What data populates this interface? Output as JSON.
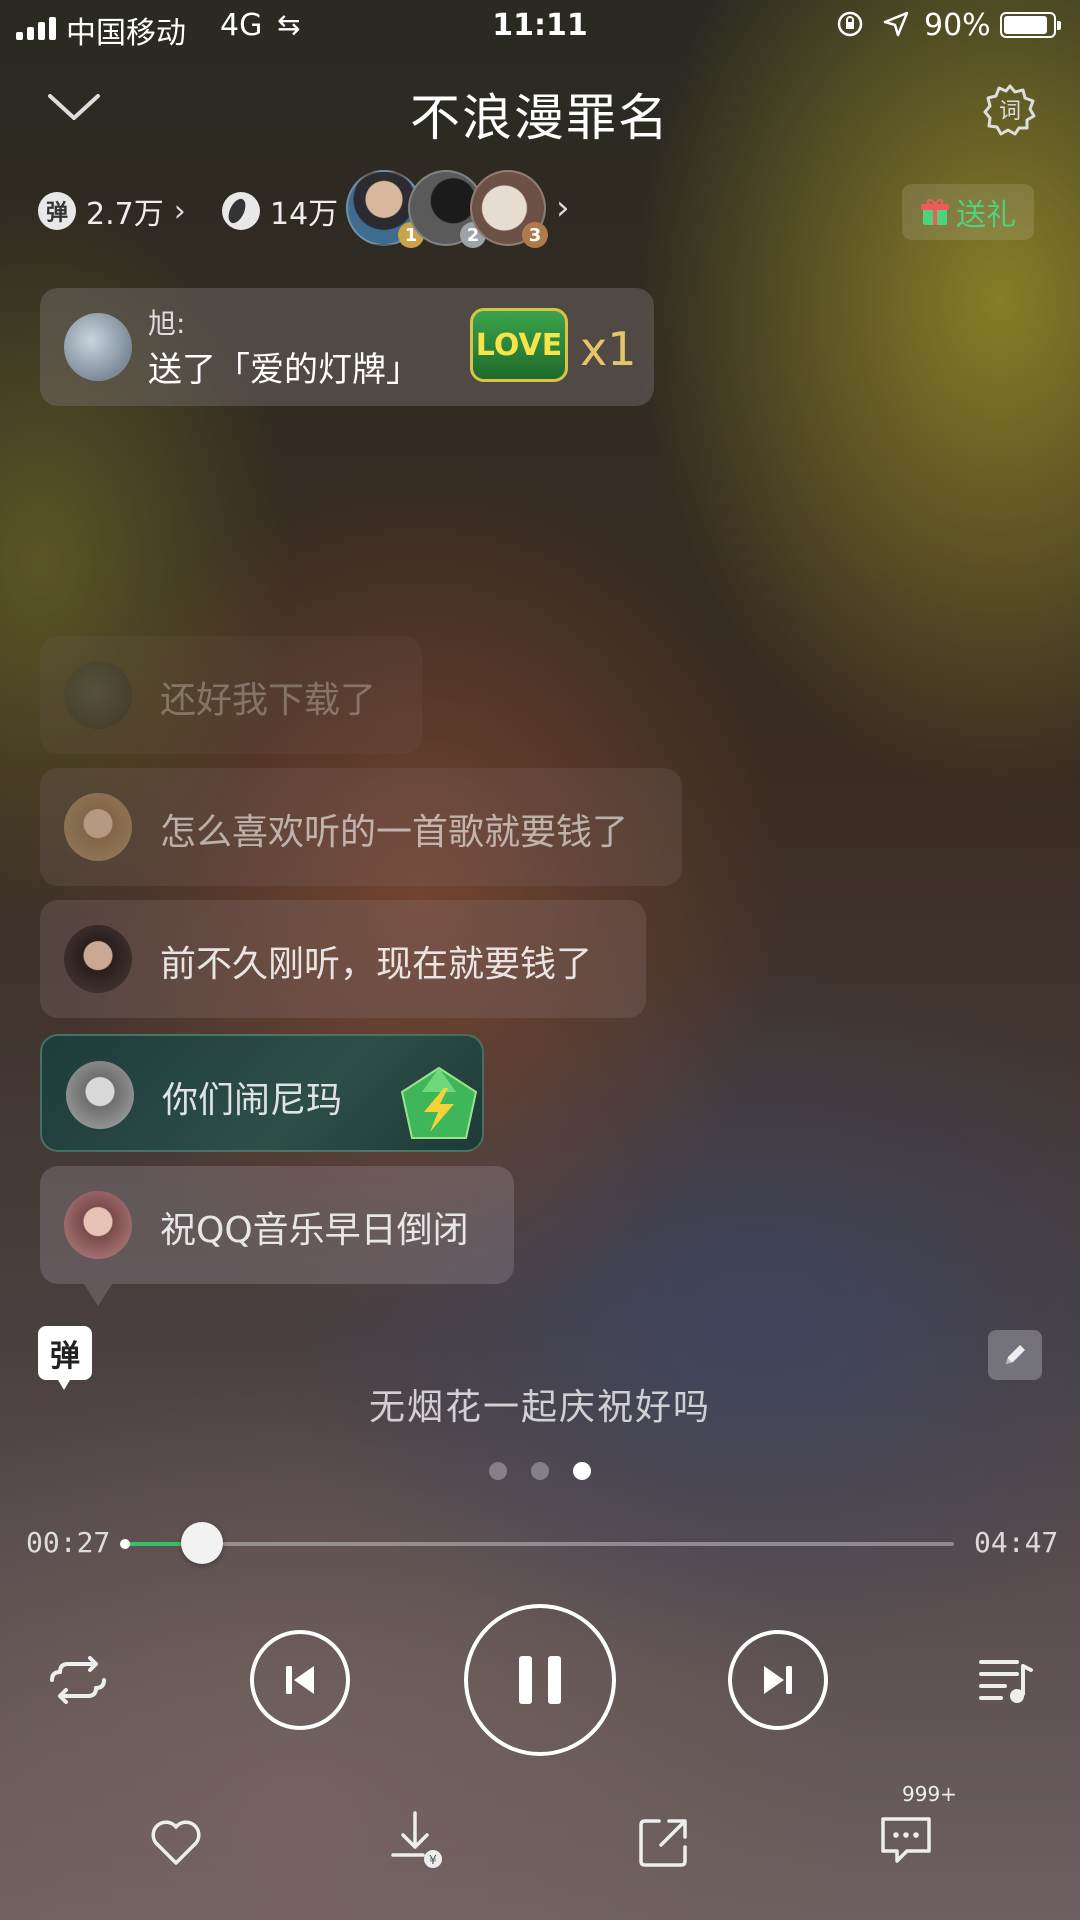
{
  "status_bar": {
    "carrier": "中国移动",
    "network": "4G",
    "time": "11:11",
    "battery_percent": "90%",
    "battery_level": 0.9
  },
  "header": {
    "song_title": "不浪漫罪名",
    "lyrics_button_label": "词"
  },
  "stats": {
    "danmu_badge": "弹",
    "danmu_count": "2.7万",
    "listeners_count": "14万",
    "ranks": [
      "1",
      "2",
      "3"
    ],
    "gift_button_label": "送礼"
  },
  "gift_notice": {
    "user": "旭:",
    "action": "送了「爱的灯牌」",
    "gift_badge_text": "LOVE",
    "count": "x1"
  },
  "comments": [
    {
      "text": "还好我下载了"
    },
    {
      "text": "怎么喜欢听的一首歌就要钱了"
    },
    {
      "text": "前不久刚听，现在就要钱了"
    },
    {
      "text": "你们闹尼玛"
    },
    {
      "text": "祝QQ音乐早日倒闭"
    }
  ],
  "danmu_toggle_label": "弹",
  "current_lyric": "无烟花一起庆祝好吗",
  "pager": {
    "pages": 3,
    "active": 3
  },
  "progress": {
    "elapsed": "00:27",
    "total": "04:47",
    "fraction": 0.094
  },
  "actions": {
    "comment_count": "999+"
  },
  "colors": {
    "accent_green": "#37c06a",
    "gift_green": "#4fd17d",
    "gold": "#e5c56a"
  }
}
